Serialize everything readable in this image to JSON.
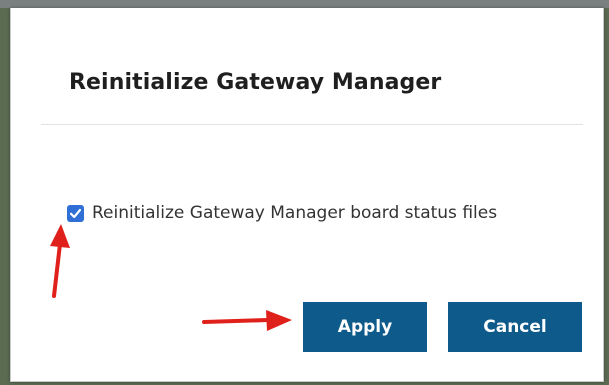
{
  "dialog": {
    "title": "Reinitialize Gateway Manager",
    "option": {
      "label": "Reinitialize Gateway Manager board status files",
      "checked": true
    },
    "buttons": {
      "apply_label": "Apply",
      "cancel_label": "Cancel"
    }
  },
  "annotations": [
    {
      "type": "arrow",
      "points_to": "checkbox",
      "color": "#e0201b"
    },
    {
      "type": "arrow",
      "points_to": "apply-button",
      "color": "#e0201b"
    }
  ],
  "colors": {
    "accent": "#2f6fd6",
    "button_bg": "#0e5a8a",
    "button_text": "#ffffff",
    "annotation_arrow": "#e0201b"
  }
}
